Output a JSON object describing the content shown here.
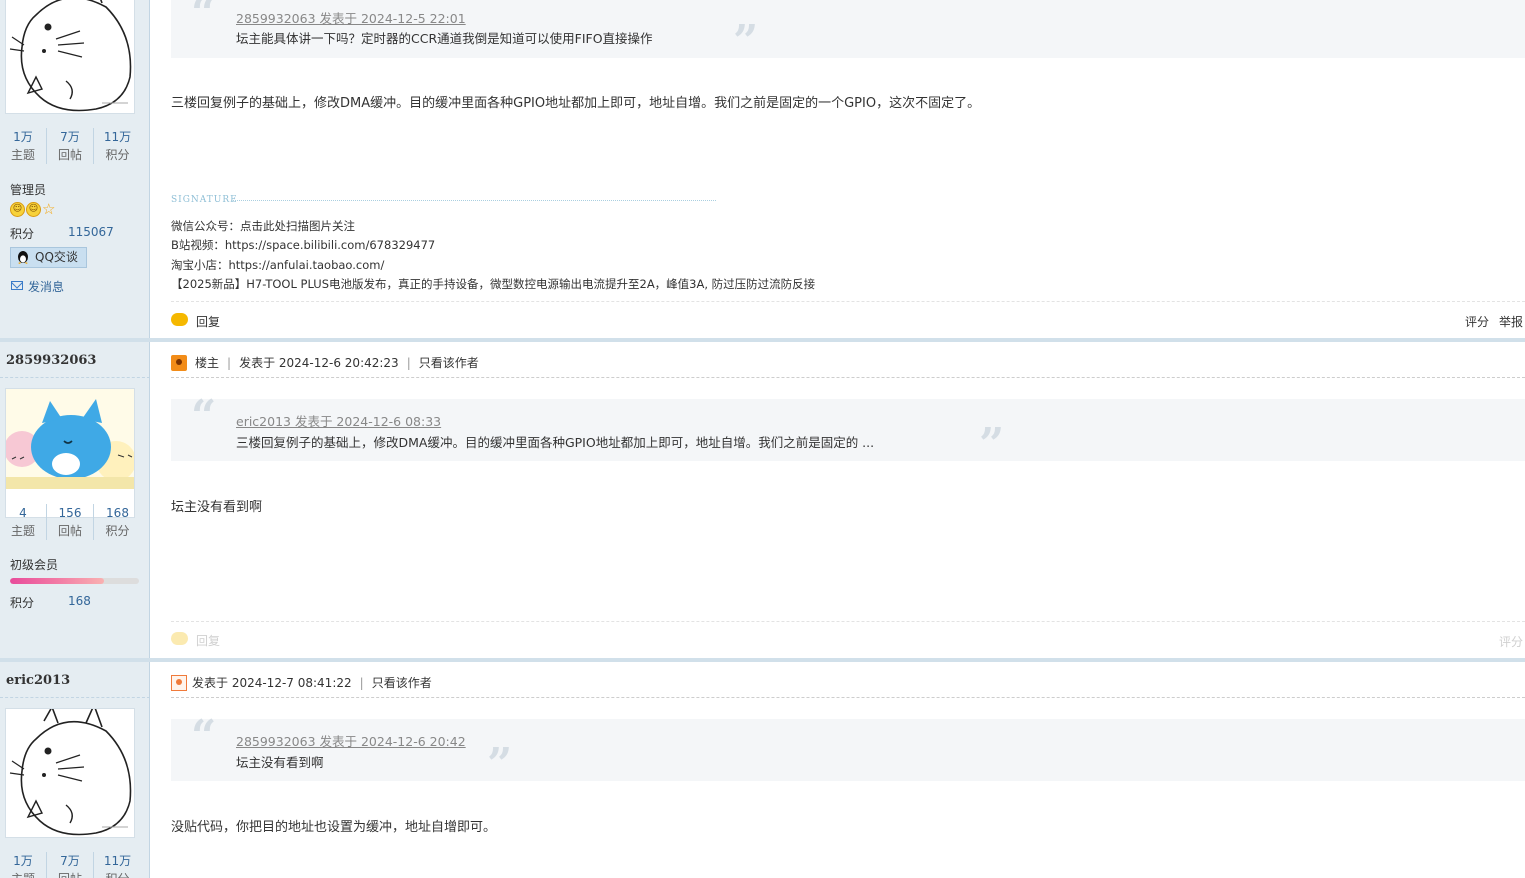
{
  "posts": [
    {
      "author": {
        "stats": [
          {
            "value": "1万",
            "label": "主题"
          },
          {
            "value": "7万",
            "label": "回帖"
          },
          {
            "value": "11万",
            "label": "积分"
          }
        ],
        "rank": "管理员",
        "credit_label": "积分",
        "credit_value": "115067",
        "qq_label": "QQ交谈",
        "message_label": "发消息"
      },
      "quote": {
        "header": "2859932063 发表于 2024-12-5 22:01",
        "text": "坛主能具体讲一下吗？定时器的CCR通道我倒是知道可以使用FIFO直接操作"
      },
      "body": "三楼回复例子的基础上，修改DMA缓冲。目的缓冲里面各种GPIO地址都加上即可，地址自增。我们之前是固定的一个GPIO，这次不固定了。",
      "signature": {
        "label": "SIGNATURE",
        "lines": [
          "微信公众号：点击此处扫描图片关注",
          "B站视频：https://space.bilibili.com/678329477",
          "淘宝小店：https://anfulai.taobao.com/",
          "【2025新品】H7-TOOL PLUS电池版发布，真正的手持设备，微型数控电源输出电流提升至2A，峰值3A, 防过压防过流防反接"
        ]
      },
      "actions": {
        "reply": "回复",
        "rate": "评分",
        "report": "举报"
      }
    },
    {
      "author": {
        "name": "2859932063",
        "stats": [
          {
            "value": "4",
            "label": "主题"
          },
          {
            "value": "156",
            "label": "回帖"
          },
          {
            "value": "168",
            "label": "积分"
          }
        ],
        "rank": "初级会员",
        "level_progress": 0.73,
        "credit_label": "积分",
        "credit_value": "168"
      },
      "meta": {
        "badge": "楼主",
        "posted": "发表于 2024-12-6 20:42:23",
        "only_author": "只看该作者"
      },
      "quote": {
        "header": "eric2013 发表于 2024-12-6 08:33",
        "text": "三楼回复例子的基础上，修改DMA缓冲。目的缓冲里面各种GPIO地址都加上即可，地址自增。我们之前是固定的 ..."
      },
      "body": "坛主没有看到啊",
      "actions": {
        "reply": "回复",
        "rate": "评分"
      }
    },
    {
      "author": {
        "name": "eric2013",
        "stats": [
          {
            "value": "1万",
            "label": "主题"
          },
          {
            "value": "7万",
            "label": "回帖"
          },
          {
            "value": "11万",
            "label": "积分"
          }
        ]
      },
      "meta": {
        "posted": "发表于 2024-12-7 08:41:22",
        "only_author": "只看该作者"
      },
      "quote": {
        "header": "2859932063 发表于 2024-12-6 20:42",
        "text": "坛主没有看到啊"
      },
      "body": "没贴代码，你把目的地址也设置为缓冲，地址自增即可。"
    }
  ]
}
